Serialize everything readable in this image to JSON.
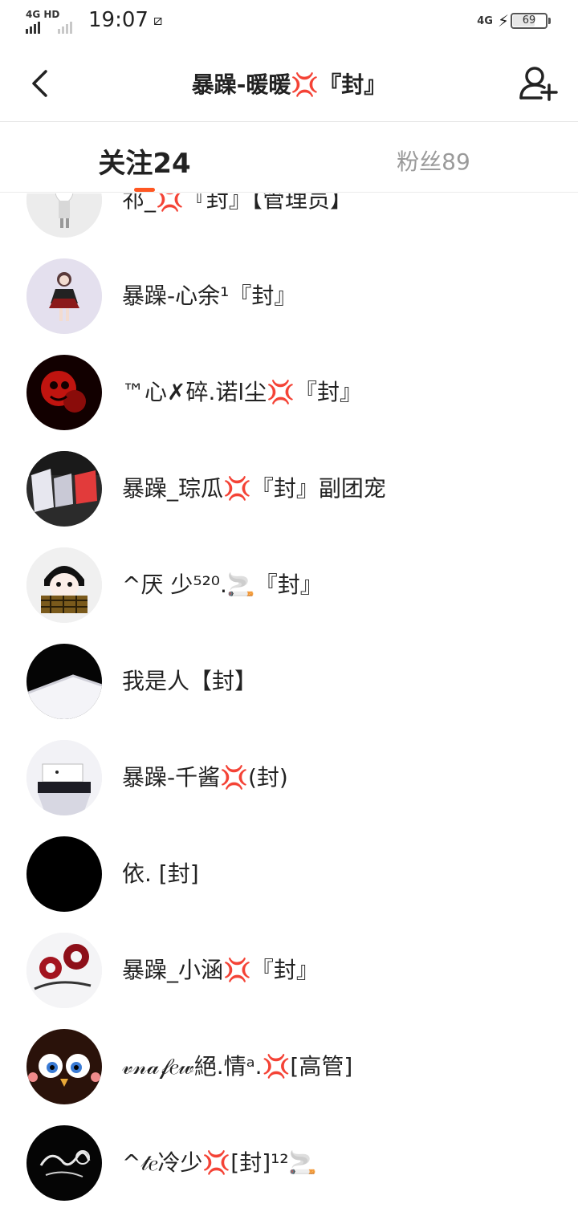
{
  "status_bar": {
    "network_left": "4G HD",
    "time": "19:07",
    "network_right": "4G",
    "battery_level": "69"
  },
  "header": {
    "title": "暴躁-暖暖💢『封』",
    "back_icon": "chevron-left-icon",
    "add_icon": "add-user-icon"
  },
  "tabs": [
    {
      "label": "关注24",
      "active": true
    },
    {
      "label": "粉丝89",
      "active": false
    }
  ],
  "colors": {
    "accent": "#ff5722",
    "inactive_tab": "#9a9a9a",
    "text": "#222222"
  },
  "users": [
    {
      "name": "祁_💢『封』【管理员】",
      "avatar": "white-hair-anime-girl"
    },
    {
      "name": "暴躁-心余¹『封』",
      "avatar": "anime-girl-red-dress"
    },
    {
      "name": "™心✗碎.诺l尘💢『封』",
      "avatar": "red-black-abstract"
    },
    {
      "name": "暴躁_琮瓜💢『封』副团宠",
      "avatar": "graffiti-letters"
    },
    {
      "name": "^厌 少⁵²⁰.🚬『封』",
      "avatar": "anime-boy-plaid-scarf"
    },
    {
      "name": "我是人【封】",
      "avatar": "black-white-diagonal"
    },
    {
      "name": "暴躁-千酱💢(封)",
      "avatar": "masked-character"
    },
    {
      "name": "依.  [封]",
      "avatar": "solid-black"
    },
    {
      "name": "暴躁_小涵💢『封』",
      "avatar": "red-roses"
    },
    {
      "name": "𝓋𝓃𝒶𝒻𝑒𝓌絕.情ᵃ.💢[高管]",
      "avatar": "owl-eyes"
    },
    {
      "name": "^𝓉𝑒冷少💢[封]¹²🚬",
      "avatar": "dark-signature-logo"
    }
  ]
}
